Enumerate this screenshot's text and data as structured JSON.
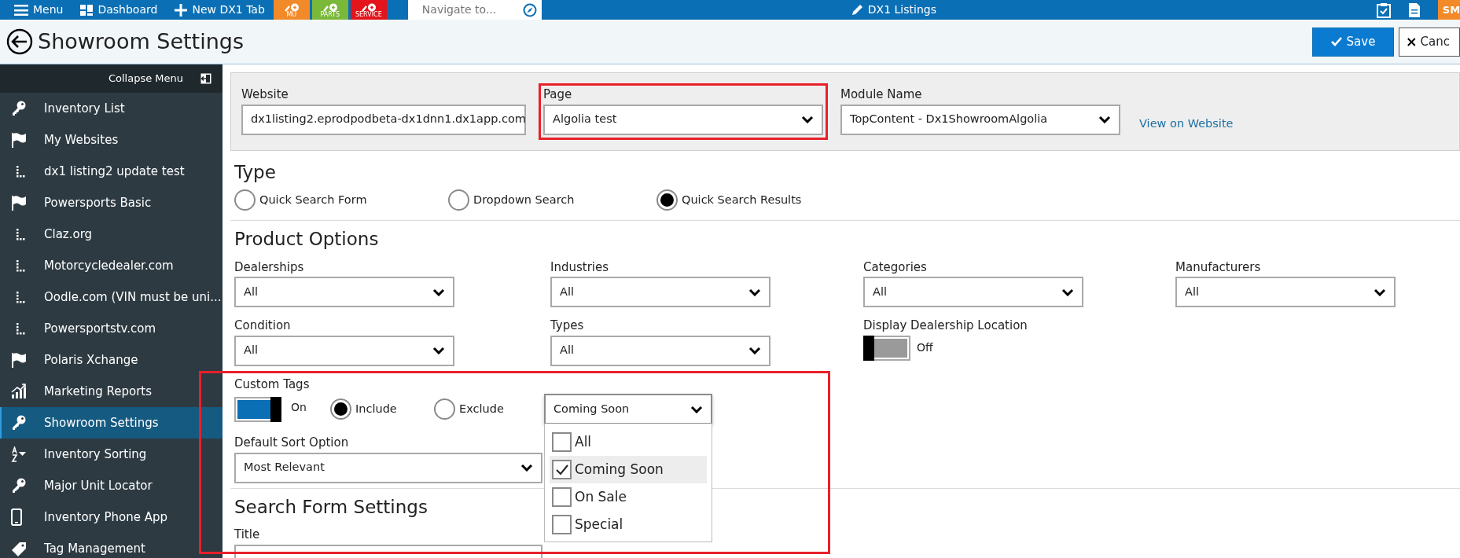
{
  "topbar": {
    "menu_items": [
      {
        "label": "Menu"
      },
      {
        "label": "Dashboard"
      },
      {
        "label": "New DX1 Tab"
      }
    ],
    "quick_buttons": [
      {
        "label": "MU",
        "color": "#f28a2a"
      },
      {
        "label": "PARTS",
        "color": "#7ab83a"
      },
      {
        "label": "SERVICE",
        "color": "#e3151b"
      }
    ],
    "search": {
      "placeholder": "Navigate to..."
    },
    "center_title": "DX1 Listings",
    "avatar": "SM"
  },
  "page": {
    "title": "Showroom Settings",
    "buttons": [
      {
        "label": "Save",
        "kind": "primary"
      },
      {
        "label": "Canc",
        "kind": "secondary"
      }
    ]
  },
  "sidebar": {
    "collapse_label": "Collapse Menu",
    "items": [
      {
        "label": "Inventory List",
        "kind": "key",
        "selected": false
      },
      {
        "label": "My Websites",
        "kind": "flag",
        "selected": false,
        "children": [
          {
            "label": "dx1 listing2 update test",
            "selected": false
          }
        ]
      },
      {
        "label": "Powersports Basic",
        "kind": "flag",
        "selected": false,
        "children": [
          {
            "label": "Claz.org",
            "selected": false
          },
          {
            "label": "Motorcycledealer.com",
            "selected": false
          },
          {
            "label": "Oodle.com (VIN must be uni...",
            "selected": false
          },
          {
            "label": "Powersportstv.com",
            "selected": false
          }
        ]
      },
      {
        "label": "Polaris Xchange",
        "kind": "flag",
        "selected": false
      },
      {
        "label": "Marketing Reports",
        "kind": "chart",
        "selected": false
      },
      {
        "label": "Showroom Settings",
        "kind": "key",
        "selected": true
      },
      {
        "label": "Inventory Sorting",
        "kind": "sort",
        "selected": false
      },
      {
        "label": "Major Unit Locator",
        "kind": "key",
        "selected": false
      },
      {
        "label": "Inventory Phone App",
        "kind": "phone",
        "selected": false
      },
      {
        "label": "Tag Management",
        "kind": "tag",
        "selected": false
      }
    ]
  },
  "selectors": {
    "fields": [
      {
        "label": "Website",
        "value": "dx1listing2.eprodpodbeta-dx1dnn1.dx1app.com",
        "highlighted": false
      },
      {
        "label": "Page",
        "value": "Algolia test",
        "highlighted": true
      },
      {
        "label": "Module Name",
        "value": "TopContent - Dx1ShowroomAlgolia",
        "highlighted": false
      }
    ],
    "link": "View on Website"
  },
  "type": {
    "heading": "Type",
    "options": [
      {
        "label": "Quick Search Form",
        "selected": false
      },
      {
        "label": "Dropdown Search",
        "selected": false
      },
      {
        "label": "Quick Search Results",
        "selected": true
      }
    ]
  },
  "product_options": {
    "heading": "Product Options",
    "fields": [
      {
        "kind": "select",
        "label": "Dealerships",
        "value": "All"
      },
      {
        "kind": "select",
        "label": "Industries",
        "value": "All"
      },
      {
        "kind": "select",
        "label": "Categories",
        "value": "All"
      },
      {
        "kind": "select",
        "label": "Manufacturers",
        "value": "All"
      },
      {
        "kind": "select",
        "label": "Condition",
        "value": "All"
      },
      {
        "kind": "select",
        "label": "Types",
        "value": "All"
      },
      {
        "kind": "toggle",
        "label": "Display Dealership Location",
        "on": false,
        "state_label": "Off"
      }
    ]
  },
  "custom_tags": {
    "label": "Custom Tags",
    "toggle": {
      "on": true,
      "state_label": "On"
    },
    "modes": [
      {
        "label": "Include",
        "selected": true
      },
      {
        "label": "Exclude",
        "selected": false
      }
    ],
    "dropdown": {
      "value": "Coming Soon",
      "expanded": true,
      "options": [
        {
          "label": "All",
          "checked": false,
          "hovered": false
        },
        {
          "label": "Coming Soon",
          "checked": true,
          "hovered": true
        },
        {
          "label": "On Sale",
          "checked": false,
          "hovered": false
        },
        {
          "label": "Special",
          "checked": false,
          "hovered": false
        }
      ]
    }
  },
  "sort": {
    "label": "Default Sort Option",
    "value": "Most Relevant"
  },
  "search_form": {
    "heading": "Search Form Settings",
    "title_label": "Title"
  }
}
